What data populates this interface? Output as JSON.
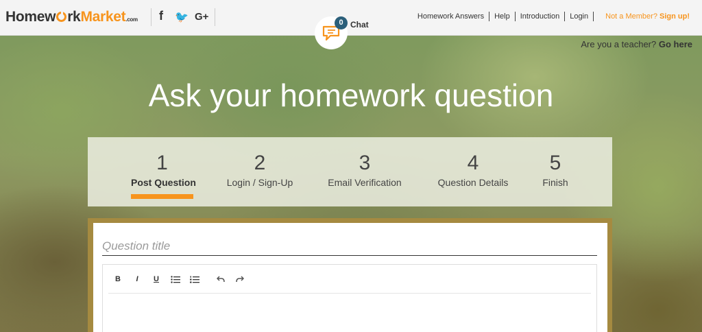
{
  "header": {
    "logo": {
      "part1": "Homew",
      "part2": "rk",
      "market": "Market",
      "tld": ".com"
    },
    "social": [
      "facebook-icon",
      "twitter-icon",
      "google-plus-icon"
    ],
    "social_glyphs": {
      "facebook": "f",
      "twitter": "🐦",
      "google_plus": "G+"
    },
    "nav": [
      {
        "label": "Homework Answers"
      },
      {
        "label": "Help"
      },
      {
        "label": "Introduction"
      },
      {
        "label": "Login"
      }
    ],
    "member_prompt": "Not a Member?",
    "signup_label": "Sign up!"
  },
  "chat": {
    "count": "0",
    "label": "Chat"
  },
  "teacher": {
    "prompt": "Are you a teacher?",
    "link": "Go here"
  },
  "hero": {
    "title": "Ask your homework question"
  },
  "steps": [
    {
      "num": "1",
      "label": "Post Question",
      "active": true
    },
    {
      "num": "2",
      "label": "Login / Sign-Up",
      "active": false
    },
    {
      "num": "3",
      "label": "Email Verification",
      "active": false
    },
    {
      "num": "4",
      "label": "Question Details",
      "active": false
    },
    {
      "num": "5",
      "label": "Finish",
      "active": false
    }
  ],
  "form": {
    "title_placeholder": "Question title",
    "toolbar": {
      "bold": "B",
      "italic": "I",
      "underline": "U",
      "bullets": "☰",
      "numbers": "≡",
      "undo": "↶",
      "redo": "↷"
    }
  },
  "colors": {
    "accent": "#f7941d",
    "badge": "#2b5f7a",
    "frame": "#a58a40"
  }
}
